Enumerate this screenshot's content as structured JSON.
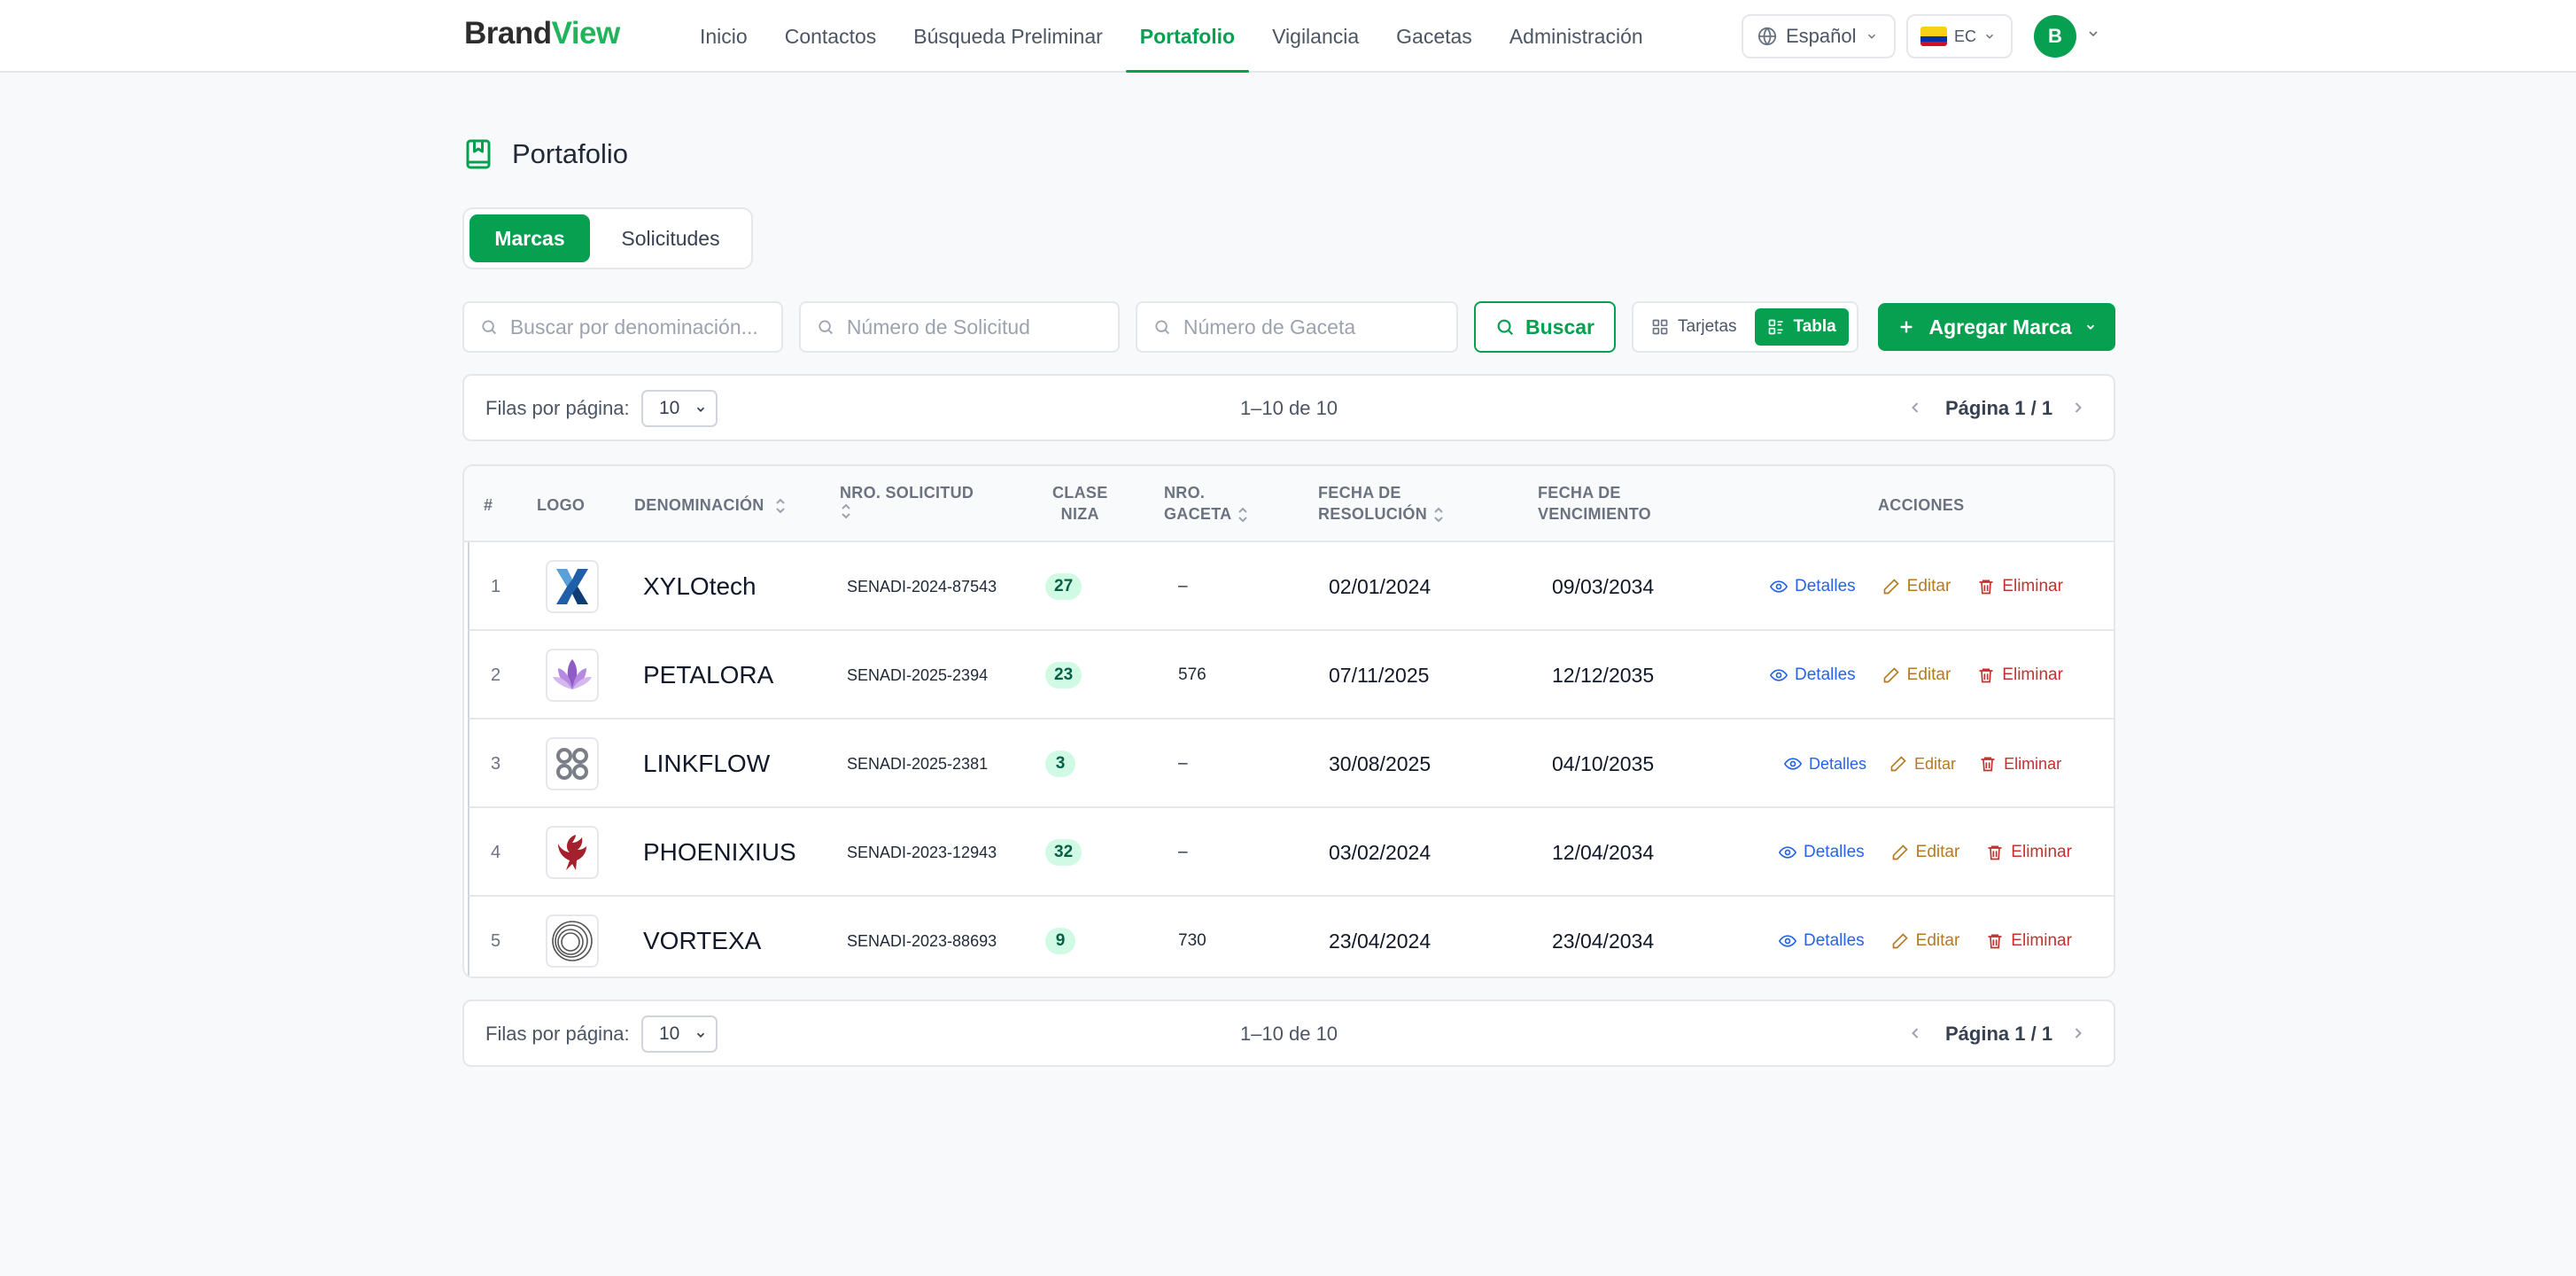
{
  "brand": {
    "part1": "Brand",
    "part2": "View"
  },
  "nav": {
    "items": [
      "Inicio",
      "Contactos",
      "Búsqueda Preliminar",
      "Portafolio",
      "Vigilancia",
      "Gacetas",
      "Administración"
    ],
    "active_index": 3
  },
  "header": {
    "language": "Español",
    "country_code": "EC",
    "user_initial": "B"
  },
  "page": {
    "title": "Portafolio"
  },
  "tabs": [
    {
      "label": "Marcas"
    },
    {
      "label": "Solicitudes"
    }
  ],
  "search": {
    "denominacion_placeholder": "Buscar por denominación...",
    "solicitud_placeholder": "Número de Solicitud",
    "gaceta_placeholder": "Número de Gaceta",
    "search_button": "Buscar"
  },
  "view_toggle": {
    "cards_label": "Tarjetas",
    "table_label": "Tabla",
    "active": "table"
  },
  "add_button": "Agregar Marca",
  "pagination": {
    "rows_label": "Filas por página:",
    "rows_value": "10",
    "range": "1–10 de 10",
    "page": "Página 1 / 1"
  },
  "table": {
    "headers": {
      "num": "#",
      "logo": "LOGO",
      "denominacion": "DENOMINACIÓN",
      "solicitud": "NRO. SOLICITUD",
      "clase_1": "CLASE",
      "clase_2": "NIZA",
      "gaceta_1": "NRO.",
      "gaceta_2": "GACETA",
      "resolucion_1": "FECHA DE",
      "resolucion_2": "RESOLUCIÓN",
      "vencimiento_1": "FECHA DE",
      "vencimiento_2": "VENCIMIENTO",
      "acciones": "ACCIONES"
    },
    "rows": [
      {
        "num": "1",
        "name": "XYLOtech",
        "solicitud": "SENADI-2024-87543",
        "clase": "27",
        "gaceta": "–",
        "resolucion": "02/01/2024",
        "vencimiento": "09/03/2034",
        "logo_icon": "x-logo-icon"
      },
      {
        "num": "2",
        "name": "PETALORA",
        "solicitud": "SENADI-2025-2394",
        "clase": "23",
        "gaceta": "576",
        "resolucion": "07/11/2025",
        "vencimiento": "12/12/2035",
        "logo_icon": "lotus-logo-icon"
      },
      {
        "num": "3",
        "name": "LINKFLOW",
        "solicitud": "SENADI-2025-2381",
        "clase": "3",
        "gaceta": "–",
        "resolucion": "30/08/2025",
        "vencimiento": "04/10/2035",
        "logo_icon": "knot-logo-icon"
      },
      {
        "num": "4",
        "name": "PHOENIXIUS",
        "solicitud": "SENADI-2023-12943",
        "clase": "32",
        "gaceta": "–",
        "resolucion": "03/02/2024",
        "vencimiento": "12/04/2034",
        "logo_icon": "phoenix-logo-icon"
      },
      {
        "num": "5",
        "name": "VORTEXA",
        "solicitud": "SENADI-2023-88693",
        "clase": "9",
        "gaceta": "730",
        "resolucion": "23/04/2024",
        "vencimiento": "23/04/2034",
        "logo_icon": "rings-logo-icon"
      }
    ],
    "actions": {
      "details": "Detalles",
      "edit": "Editar",
      "delete": "Eliminar"
    }
  },
  "colors": {
    "primary": "#07a050",
    "details": "#2563eb",
    "edit": "#b7791f",
    "delete": "#c53030"
  }
}
